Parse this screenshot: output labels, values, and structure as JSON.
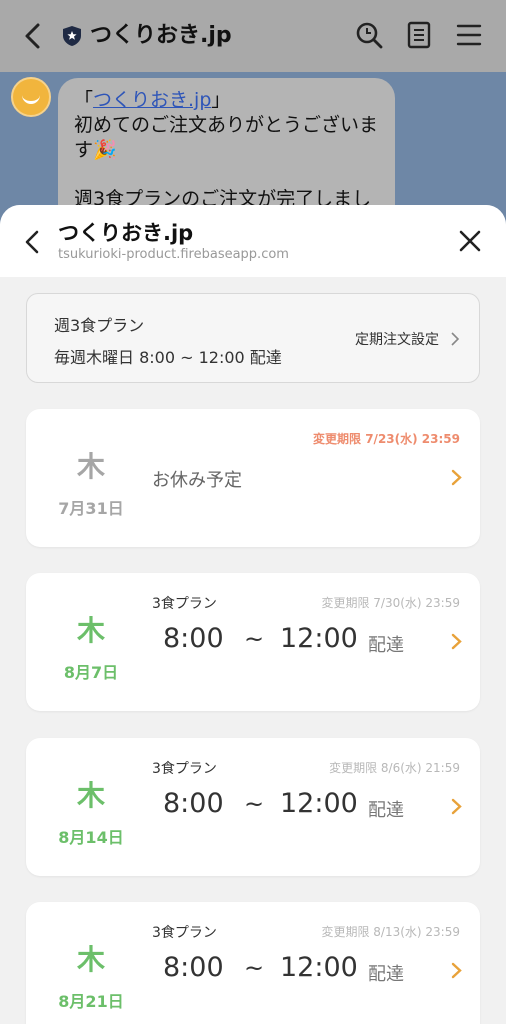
{
  "chat": {
    "title": "つくりおき.jp",
    "bubble_open": "「",
    "bubble_link": "つくりおき.jp",
    "bubble_close": "」",
    "bubble_line2": "初めてのご注文ありがとうございます🎉",
    "bubble_line3": "週3食プランのご注文が完了しまし"
  },
  "sheet": {
    "title": "つくりおき.jp",
    "url": "tsukurioki-product.firebaseapp.com"
  },
  "plan": {
    "name": "週3食プラン",
    "schedule": "毎週木曜日 8:00 ~ 12:00 配達",
    "settings_label": "定期注文設定"
  },
  "deliveries": [
    {
      "day": "木",
      "date": "7月31日",
      "deadline": "変更期限 7/23(水) 23:59",
      "status": "お休み予定"
    },
    {
      "day": "木",
      "date": "8月7日",
      "deadline": "変更期限 7/30(水) 23:59",
      "meal_plan": "3食プラン",
      "time_start": "8:00",
      "tilde": "~",
      "time_end": "12:00",
      "action": "配達"
    },
    {
      "day": "木",
      "date": "8月14日",
      "deadline": "変更期限 8/6(水) 21:59",
      "meal_plan": "3食プラン",
      "time_start": "8:00",
      "tilde": "~",
      "time_end": "12:00",
      "action": "配達"
    },
    {
      "day": "木",
      "date": "8月21日",
      "deadline": "変更期限 8/13(水) 23:59",
      "meal_plan": "3食プラン",
      "time_start": "8:00",
      "tilde": "~",
      "time_end": "12:00",
      "action": "配達"
    }
  ],
  "colors": {
    "holiday_gray": "#a6a6a6",
    "delivery_green": "#6cbf6a",
    "deadline_alert": "#ee8c6e",
    "chevron_orange": "#e8a23a"
  }
}
